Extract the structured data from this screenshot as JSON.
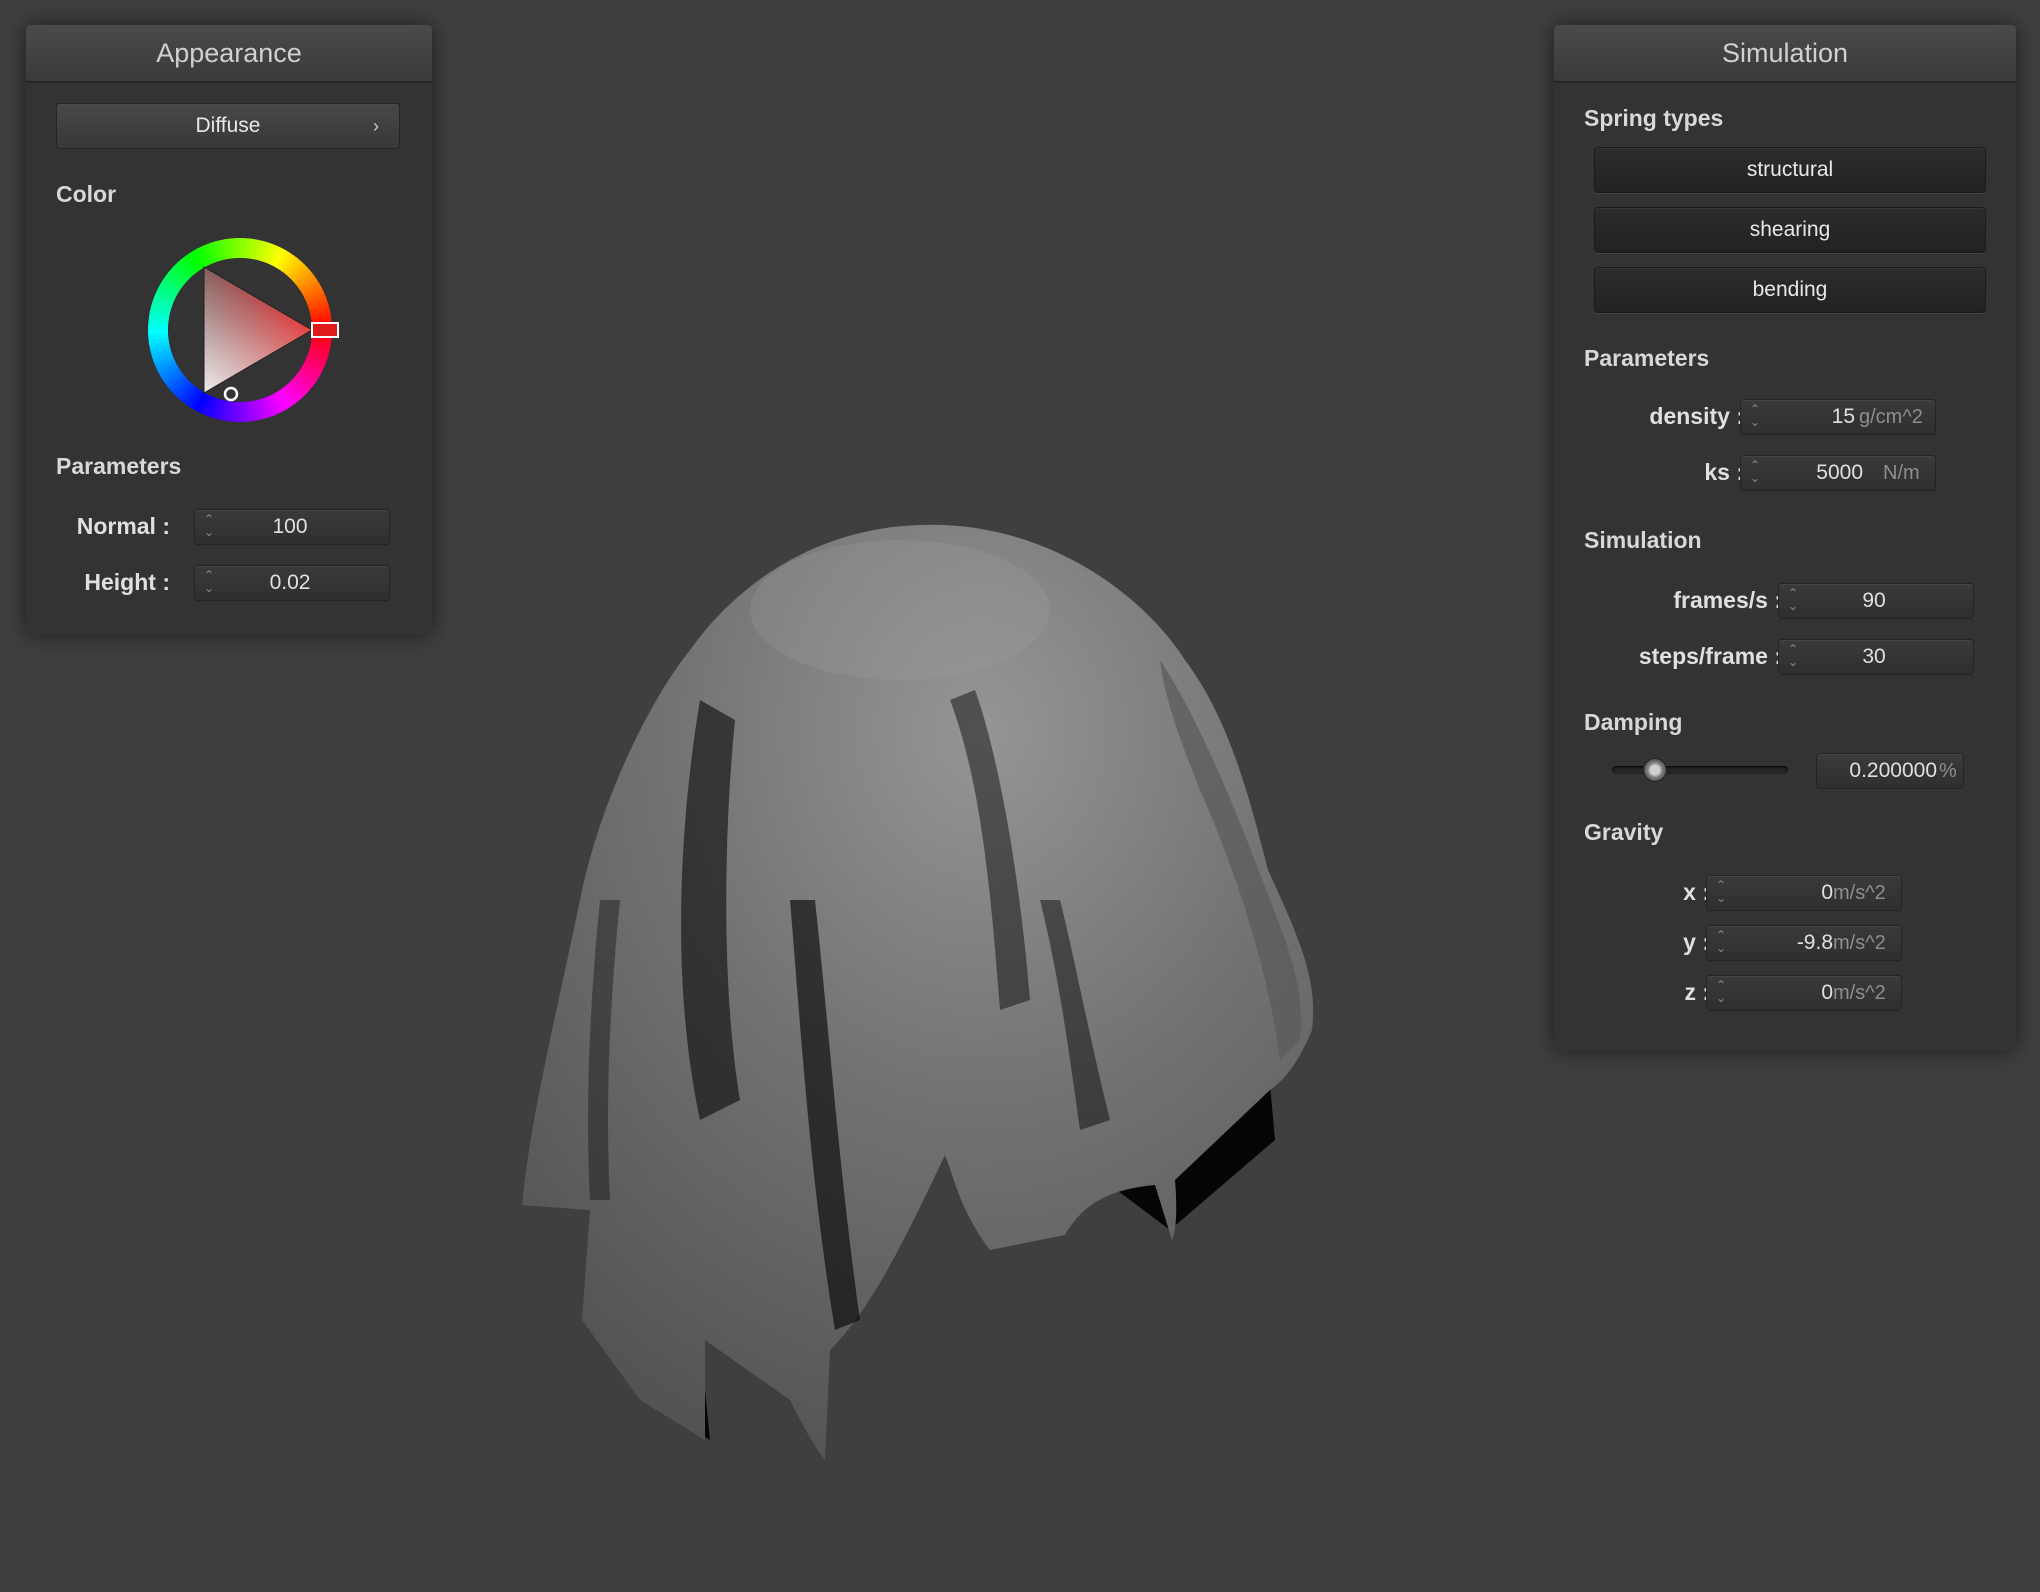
{
  "appearance": {
    "title": "Appearance",
    "material_select": "Diffuse",
    "chevron": "chevron-right-icon",
    "color_label": "Color",
    "parameters_label": "Parameters",
    "normal_label": "Normal :",
    "normal_value": "100",
    "height_label": "Height :",
    "height_value": "0.02",
    "selected_color": "#e01a1a"
  },
  "simulation": {
    "title": "Simulation",
    "spring_types_label": "Spring types",
    "spring_buttons": [
      "structural",
      "shearing",
      "bending"
    ],
    "parameters_label": "Parameters",
    "density_label": "density :",
    "density_value": "15",
    "density_unit": "g/cm^2",
    "ks_label": "ks :",
    "ks_value": "5000",
    "ks_unit": "N/m",
    "simulation_label": "Simulation",
    "fps_label": "frames/s :",
    "fps_value": "90",
    "steps_label": "steps/frame :",
    "steps_value": "30",
    "damping_label": "Damping",
    "damping_value": "0.200000",
    "damping_unit": "%",
    "damping_slider_fraction": 0.2,
    "gravity_label": "Gravity",
    "gx_label": "x :",
    "gx_value": "0",
    "gy_label": "y :",
    "gy_value": "-9.8",
    "gz_label": "z :",
    "gz_value": "0",
    "gravity_unit": "m/s^2"
  },
  "colors": {
    "background": "#3f3f3f",
    "panel": "#333333",
    "cloth": "#7a7a7a"
  }
}
